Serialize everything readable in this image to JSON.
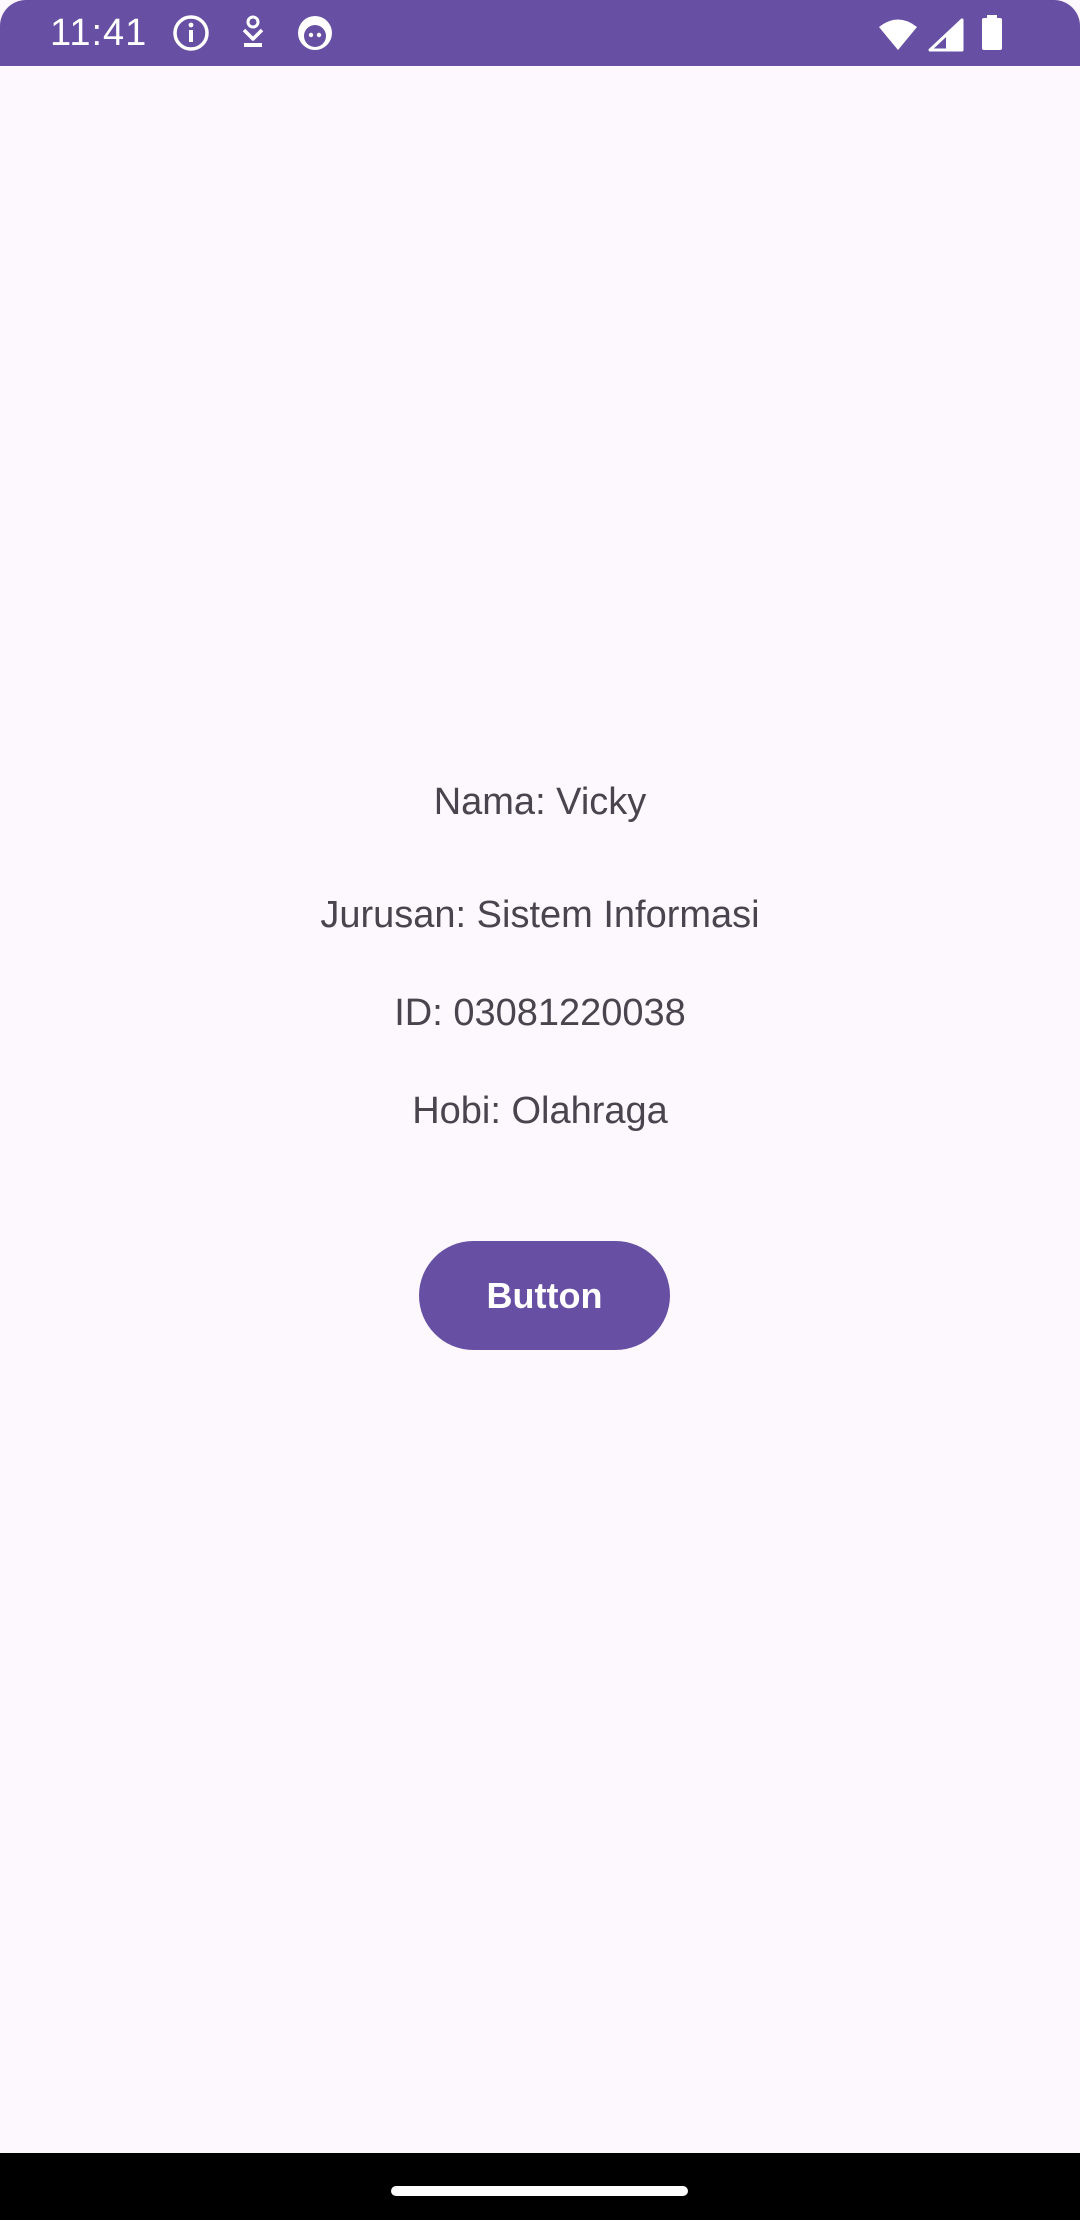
{
  "status_bar": {
    "time": "11:41",
    "background": "#6750A4",
    "icons_left": [
      "info-icon",
      "download-icon",
      "face-icon"
    ],
    "icons_right": [
      "wifi-icon",
      "signal-icon",
      "battery-icon"
    ]
  },
  "profile": {
    "name": "Nama: Vicky",
    "major": "Jurusan: Sistem Informasi",
    "id": "ID: 03081220038",
    "hobby": "Hobi: Olahraga"
  },
  "button": {
    "label": "Button",
    "color": "#6750A4"
  },
  "colors": {
    "background": "#FDF7FE",
    "text": "#49454F",
    "accent": "#6750A4"
  }
}
